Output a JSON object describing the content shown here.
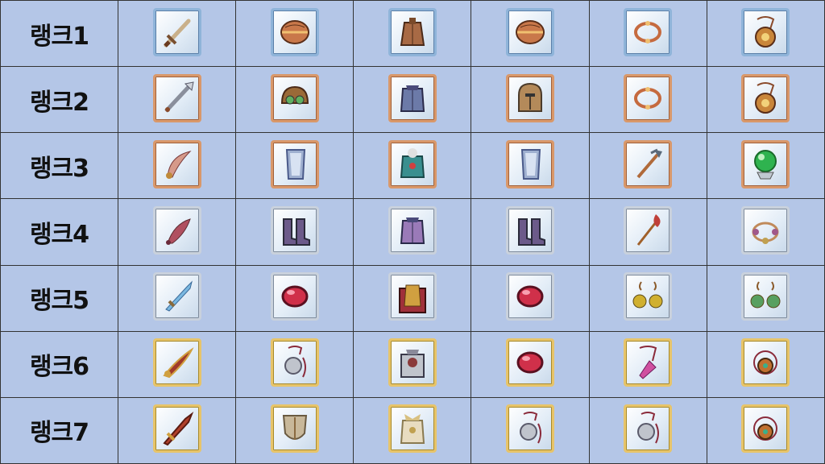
{
  "rows": [
    {
      "label": "랭크1",
      "tier": "blue",
      "items": [
        {
          "icon": "sword-icon",
          "color": "#c9b08a"
        },
        {
          "icon": "round-shield-icon",
          "color": "#c9784a"
        },
        {
          "icon": "leather-armor-icon",
          "color": "#a86a45"
        },
        {
          "icon": "round-shield-icon",
          "color": "#c9784a"
        },
        {
          "icon": "bracelet-icon",
          "color": "#c56a3f"
        },
        {
          "icon": "amulet-icon",
          "color": "#c9863a"
        }
      ]
    },
    {
      "label": "랭크2",
      "tier": "copper",
      "items": [
        {
          "icon": "spear-blade-icon",
          "color": "#8a8f9c"
        },
        {
          "icon": "goggle-helmet-icon",
          "color": "#9a6a38"
        },
        {
          "icon": "plate-armor-icon",
          "color": "#6c7aa8"
        },
        {
          "icon": "knight-helmet-icon",
          "color": "#b48a5a"
        },
        {
          "icon": "bracelet-icon",
          "color": "#c56a3f"
        },
        {
          "icon": "amulet-icon",
          "color": "#c9863a"
        }
      ]
    },
    {
      "label": "랭크3",
      "tier": "copper",
      "items": [
        {
          "icon": "scimitar-icon",
          "color": "#d69a8a"
        },
        {
          "icon": "tower-shield-icon",
          "color": "#9fb0d0"
        },
        {
          "icon": "beast-armor-icon",
          "color": "#3a8f8f"
        },
        {
          "icon": "tower-shield-icon",
          "color": "#9fb0d0"
        },
        {
          "icon": "trident-icon",
          "color": "#b06a3a"
        },
        {
          "icon": "crystal-orb-icon",
          "color": "#2fb34f"
        }
      ]
    },
    {
      "label": "랭크4",
      "tier": "silver",
      "items": [
        {
          "icon": "curved-blade-icon",
          "color": "#b05060"
        },
        {
          "icon": "boots-icon",
          "color": "#6c5a8a"
        },
        {
          "icon": "plate-armor-icon",
          "color": "#9a7ab8"
        },
        {
          "icon": "boots-icon",
          "color": "#6c5a8a"
        },
        {
          "icon": "fire-staff-icon",
          "color": "#c0403a"
        },
        {
          "icon": "bead-bracelet-icon",
          "color": "#a0588a"
        }
      ]
    },
    {
      "label": "랭크5",
      "tier": "silver",
      "items": [
        {
          "icon": "ice-sword-icon",
          "color": "#7ab8e0"
        },
        {
          "icon": "red-gem-icon",
          "color": "#d0304a"
        },
        {
          "icon": "caped-armor-icon",
          "color": "#a0303a"
        },
        {
          "icon": "red-gem-icon",
          "color": "#d0304a"
        },
        {
          "icon": "earrings-icon",
          "color": "#d0b030"
        },
        {
          "icon": "earrings-icon",
          "color": "#58a060"
        }
      ]
    },
    {
      "label": "랭크6",
      "tier": "gold",
      "items": [
        {
          "icon": "ornate-sword-icon",
          "color": "#a03a2a"
        },
        {
          "icon": "lion-pendant-icon",
          "color": "#c0c4cc"
        },
        {
          "icon": "red-plate-armor-icon",
          "color": "#8a3a3a"
        },
        {
          "icon": "red-gem-icon",
          "color": "#d0304a"
        },
        {
          "icon": "pink-crystal-pendant-icon",
          "color": "#d050a0"
        },
        {
          "icon": "jade-medallion-icon",
          "color": "#c07030"
        }
      ]
    },
    {
      "label": "랭크7",
      "tier": "gold",
      "items": [
        {
          "icon": "greatsword-icon",
          "color": "#b0402a"
        },
        {
          "icon": "crest-shield-icon",
          "color": "#c8b89a"
        },
        {
          "icon": "white-armor-icon",
          "color": "#e8dcc0"
        },
        {
          "icon": "lion-pendant-icon",
          "color": "#c0c4cc"
        },
        {
          "icon": "lion-pendant-icon",
          "color": "#c0c4cc"
        },
        {
          "icon": "jade-medallion-icon",
          "color": "#c07030"
        }
      ]
    }
  ]
}
